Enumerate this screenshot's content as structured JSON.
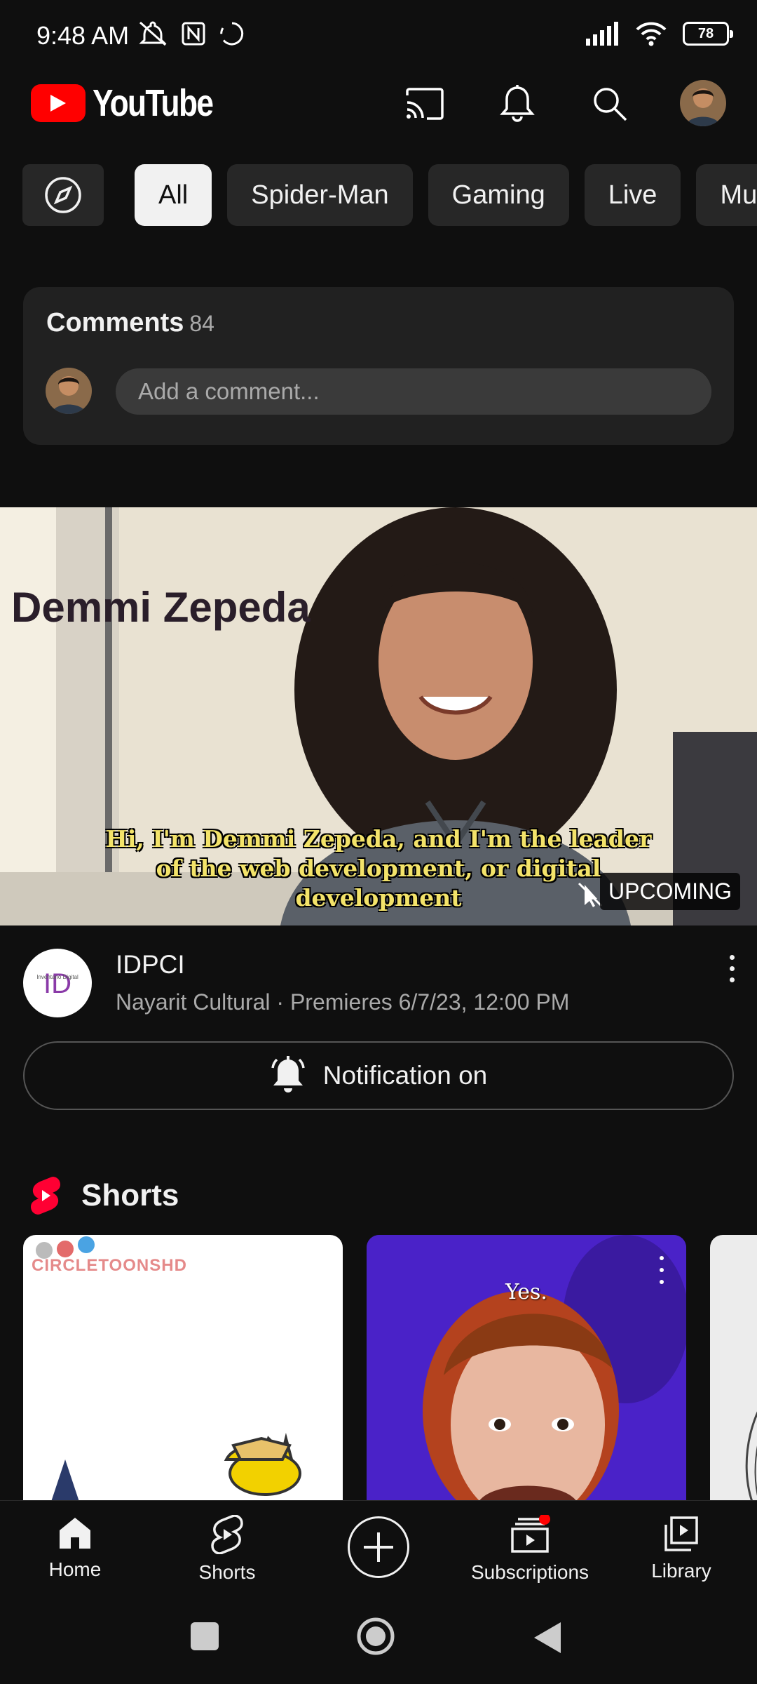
{
  "status_bar": {
    "time": "9:48 AM",
    "battery": "78"
  },
  "header": {
    "logo_text": "YouTube"
  },
  "chips": [
    "All",
    "Spider-Man",
    "Gaming",
    "Live",
    "Mu"
  ],
  "comments": {
    "title": "Comments",
    "count": "84",
    "placeholder": "Add a comment..."
  },
  "video": {
    "overlay_name": "Demmi Zepeda",
    "subtitle": "Hi, I'm Demmi Zepeda, and I'm the leader of the web development, or digital development",
    "badge": "UPCOMING",
    "title": "IDPCI",
    "meta": "Nayarit Cultural · Premieres 6/7/23, 12:00 PM",
    "notify_label": "Notification on"
  },
  "shorts": {
    "title": "Shorts",
    "items": [
      {
        "watermark": "CIRCLETOONSHD"
      },
      {
        "caption": "Yes."
      }
    ]
  },
  "bottom_nav": {
    "home": "Home",
    "shorts": "Shorts",
    "subscriptions": "Subscriptions",
    "library": "Library"
  },
  "colors": {
    "brand_red": "#ff0000",
    "background": "#0f0f0f",
    "chip_bg": "#272727",
    "card_bg": "#212121"
  }
}
